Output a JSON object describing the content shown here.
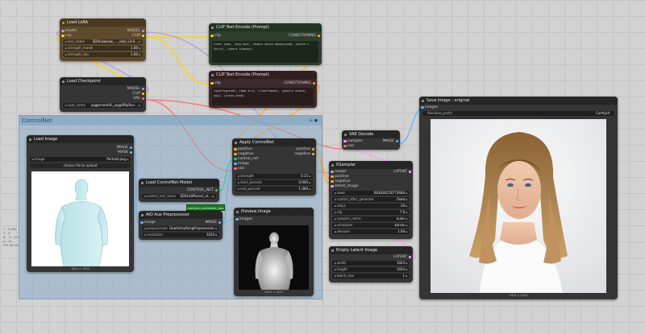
{
  "side_stats": [
    "T: 0.00s",
    "I: 0",
    "N: 11 [11]",
    "V: 21",
    "FPS:60.61"
  ],
  "group": {
    "title": "ControlNet",
    "icons": "☰ ●"
  },
  "nodes": {
    "lora": {
      "id": "#1790",
      "title": "Load LoRA",
      "inputs": [
        "model",
        "clip"
      ],
      "outputs": [
        "MODEL",
        "CLIP"
      ],
      "widgets": [
        {
          "k": "lora_name",
          "v": "SDXLlowsaw_…_sdxl_v3-0…"
        },
        {
          "k": "strength_model",
          "v": "1.00"
        },
        {
          "k": "strength_clip",
          "v": "1.00"
        }
      ]
    },
    "checkpoint": {
      "id": "#4788",
      "title": "Load Checkpoint",
      "outputs": [
        "MODEL",
        "CLIP",
        "VAE"
      ],
      "widgets": [
        {
          "k": "ckpt_name",
          "v": "juggernautXL_juggXIByRun…"
        }
      ]
    },
    "clip_pos": {
      "id": "#3750",
      "title": "CLIP Text Encode (Prompt)",
      "input": "clip",
      "output": "CONDITIONING",
      "text": "clear eyes, long hair, simple white background, (white t-shirt), (short sleeves)"
    },
    "clip_neg": {
      "id": "#789",
      "title": "CLIP Text Encode (Prompt)",
      "input": "clip",
      "output": "CONDITIONING",
      "text": "(skinfigured), (bad art), (lineframed), (poorly drawn), ugly, (cross-eyed)"
    },
    "load_image": {
      "id": "#4880",
      "title": "Load Image",
      "outputs": [
        "IMAGE",
        "MASK"
      ],
      "widgets": [
        {
          "k": "image",
          "v": "Portrait.png"
        }
      ],
      "button": "choose file to upload",
      "caption": "1024 × 1024"
    },
    "cn_model": {
      "id": "#1088",
      "title": "Load ControlNet Model",
      "output": "CONTROL_NET",
      "widgets": [
        {
          "k": "control_net_name",
          "v": "SDXL\\diffusers_xl…"
        }
      ]
    },
    "aio": {
      "id": "#1726",
      "title": "AIO Aux Preprocessor",
      "input": "image",
      "output": "IMAGE",
      "widgets": [
        {
          "k": "preprocessor",
          "v": "DepthAnythingPreprocessor"
        },
        {
          "k": "resolution",
          "v": "1024"
        }
      ]
    },
    "apply_cn": {
      "id": "#4700",
      "title": "Apply ControlNet",
      "inputs": [
        "positive",
        "negative",
        "control_net",
        "image",
        "vae"
      ],
      "outputs": [
        "positive",
        "negative"
      ],
      "widgets": [
        {
          "k": "strength",
          "v": "0.15"
        },
        {
          "k": "start_percent",
          "v": "0.000"
        },
        {
          "k": "end_percent",
          "v": "1.000"
        }
      ]
    },
    "preview": {
      "id": "#4700",
      "title": "Preview Image",
      "input": "images",
      "caption": "1024 × 1024"
    },
    "vae": {
      "id": "#4880",
      "title": "VAE Decode",
      "inputs": [
        "samples",
        "vae"
      ],
      "output": "IMAGE"
    },
    "ksampler": {
      "id": "#1 1ad",
      "title": "KSampler",
      "inputs": [
        "model",
        "positive",
        "negative",
        "latent_image"
      ],
      "output": "LATENT",
      "widgets": [
        {
          "k": "seed",
          "v": "663616278773606"
        },
        {
          "k": "control_after_generate",
          "v": "fixed"
        },
        {
          "k": "steps",
          "v": "20"
        },
        {
          "k": "cfg",
          "v": "7.0"
        },
        {
          "k": "sampler_name",
          "v": "euler"
        },
        {
          "k": "scheduler",
          "v": "karras"
        },
        {
          "k": "denoise",
          "v": "1.00"
        }
      ]
    },
    "latent": {
      "id": "#1 1e7",
      "title": "Empty Latent Image",
      "output": "LATENT",
      "widgets": [
        {
          "k": "width",
          "v": "1024"
        },
        {
          "k": "height",
          "v": "1024"
        },
        {
          "k": "batch_size",
          "v": "1"
        }
      ]
    },
    "save": {
      "id": "#1778",
      "title": "Save Image - original",
      "input": "images",
      "widgets": [
        {
          "k": "filename_prefix",
          "v": "ComfyUI"
        }
      ],
      "caption": "1024 × 1024"
    }
  },
  "badge": "comfyui_controlnet_aux",
  "colors": {
    "clip": "#ffd500",
    "model": "#b39ddb",
    "vae": "#ff6e6e",
    "cond": "#ffa931",
    "image": "#64b5f6",
    "latent": "#ff9cf9",
    "control": "#00d78d"
  }
}
